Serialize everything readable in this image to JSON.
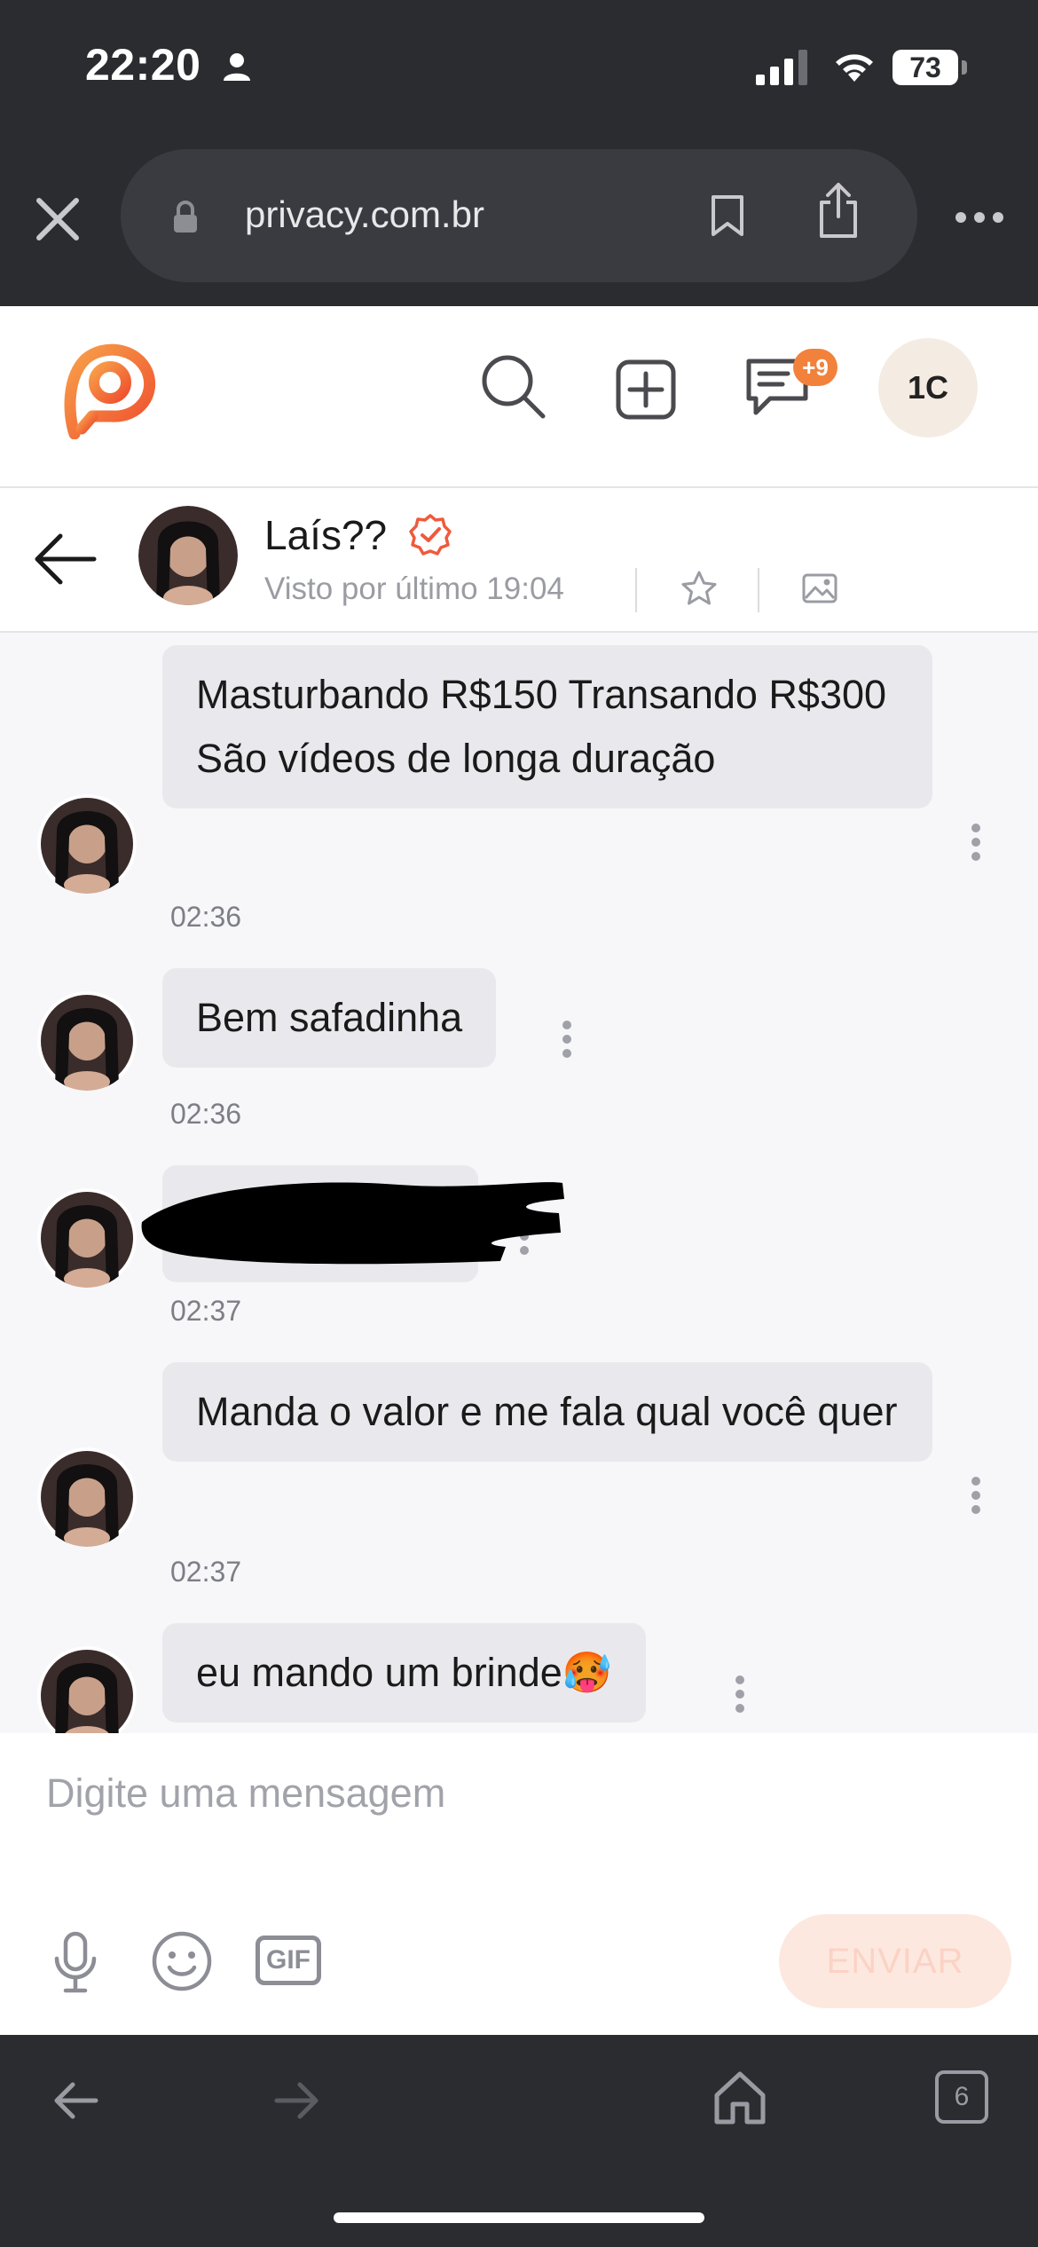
{
  "status_bar": {
    "time": "22:20",
    "battery": "73"
  },
  "browser": {
    "url": "privacy.com.br",
    "tab_count": "6"
  },
  "app_header": {
    "messages_badge": "+9",
    "user_initials": "1C"
  },
  "chat_header": {
    "contact_name": "Laís??",
    "last_seen": "Visto por último 19:04"
  },
  "messages": [
    {
      "text": "Masturbando R$150 Transando R$300 São vídeos de longa duração",
      "time": "02:36"
    },
    {
      "text": "Bem safadinha",
      "time": "02:36"
    },
    {
      "text": "",
      "time": "02:37",
      "redacted": true
    },
    {
      "text": "Manda o valor e me fala qual você quer",
      "time": "02:37"
    },
    {
      "text": "eu mando um brinde🥵",
      "time": ""
    }
  ],
  "composer": {
    "placeholder": "Digite uma mensagem",
    "gif_label": "GIF",
    "send_label": "ENVIAR"
  },
  "colors": {
    "brand_orange": "#f2813b",
    "verified_red": "#ef5a3c",
    "send_disabled_bg": "#fde8e0"
  }
}
